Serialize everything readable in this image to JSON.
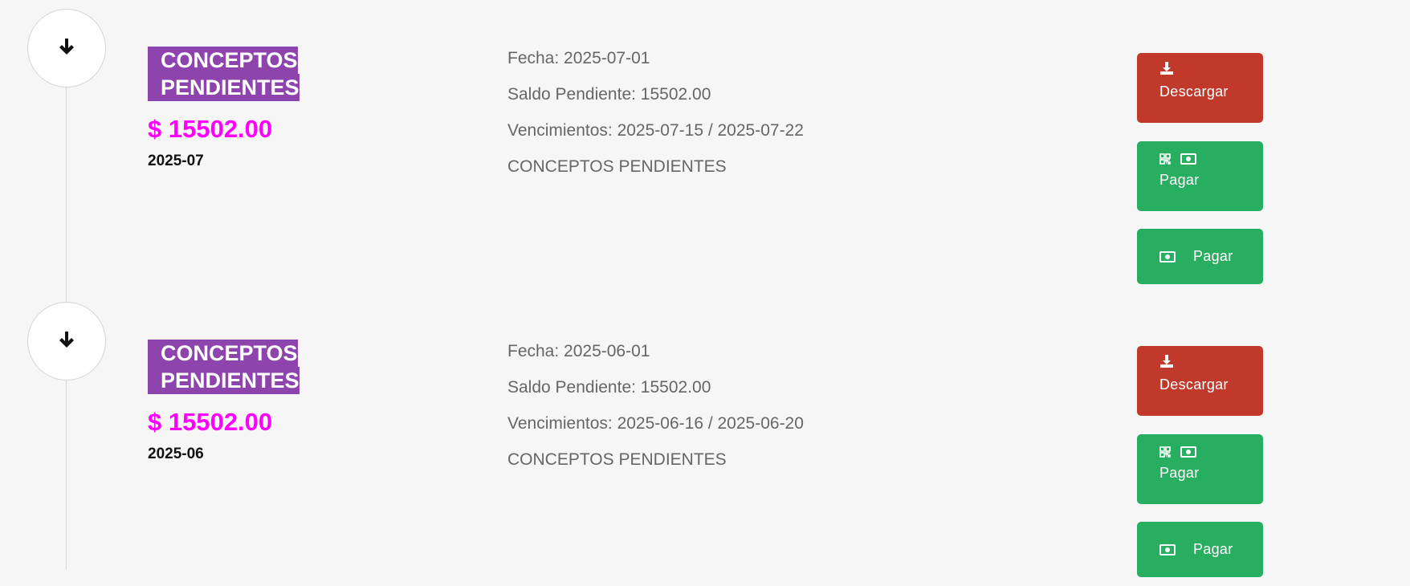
{
  "entries": [
    {
      "tag": "CONCEPTOS PENDIENTES",
      "amount": "$ 15502.00",
      "period": "2025-07",
      "fecha": "Fecha: 2025-07-01",
      "saldo": "Saldo Pendiente: 15502.00",
      "vencimientos": "Vencimientos: 2025-07-15 / 2025-07-22",
      "concepto": "CONCEPTOS PENDIENTES",
      "download_label": "Descargar",
      "pay_qr_label": "Pagar",
      "pay_cash_label": "Pagar"
    },
    {
      "tag": "CONCEPTOS PENDIENTES",
      "amount": "$ 15502.00",
      "period": "2025-06",
      "fecha": "Fecha: 2025-06-01",
      "saldo": "Saldo Pendiente: 15502.00",
      "vencimientos": "Vencimientos: 2025-06-16 / 2025-06-20",
      "concepto": "CONCEPTOS PENDIENTES",
      "download_label": "Descargar",
      "pay_qr_label": "Pagar",
      "pay_cash_label": "Pagar"
    }
  ],
  "icons": {
    "timeline": "arrow-down-icon",
    "download": "download-icon",
    "qr": "qrcode-icon",
    "cash": "money-bill-icon"
  },
  "colors": {
    "tag_bg": "#8e44ad",
    "amount": "#ff00ff",
    "download_btn": "#c0392b",
    "pay_btn": "#27ae60"
  }
}
